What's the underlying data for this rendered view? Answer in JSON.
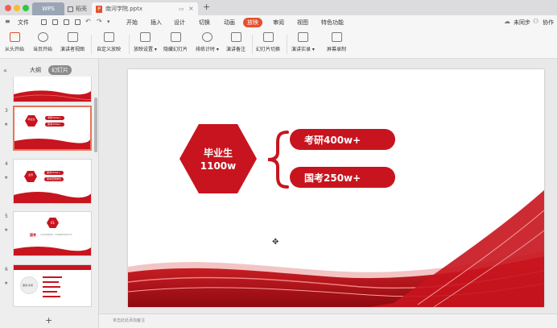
{
  "titlebar": {
    "tabs": [
      {
        "label": "WPS"
      },
      {
        "label": "稻壳"
      },
      {
        "label": "南河学院.pptx"
      }
    ]
  },
  "menu": {
    "file_label": "文件",
    "items": [
      "开始",
      "插入",
      "设计",
      "切换",
      "动画",
      "放映",
      "审阅",
      "视图",
      "特色功能"
    ],
    "active": "放映",
    "sync_label": "未同步",
    "collab_label": "协作"
  },
  "toolbar": {
    "buttons": [
      "从头开始",
      "当页开始",
      "演讲者视图",
      "自定义放映",
      "放映设置 ▾",
      "隐藏幻灯片",
      "排练计时 ▾",
      "演讲备注",
      "幻灯片切换",
      "演讲实录 ▾",
      "屏幕录制"
    ]
  },
  "left_panel": {
    "tab_outline": "大纲",
    "tab_slides": "幻灯片",
    "add_button": "+",
    "thumbs": [
      {
        "num": "3",
        "hex": "毕业生",
        "lines": [
          "考研400w+",
          "国考250w+"
        ]
      },
      {
        "num": "4",
        "hex": "业界",
        "lines": [
          "国考250w+",
          "国考招录岗位"
        ]
      },
      {
        "num": "5",
        "badge": "01",
        "title": "国考",
        "sub": "中央及其直属机构 · 中央直属机构的地方分支"
      },
      {
        "num": "6",
        "title": "国考·省考"
      }
    ]
  },
  "slide": {
    "hex_line1": "毕业生",
    "hex_line2": "1100w",
    "pill1": "考研400w+",
    "pill2": "国考250w+"
  },
  "notes": {
    "placeholder": "单击此处添加备注"
  },
  "colors": {
    "accent": "#e5512e",
    "slide_red": "#c8141e"
  }
}
